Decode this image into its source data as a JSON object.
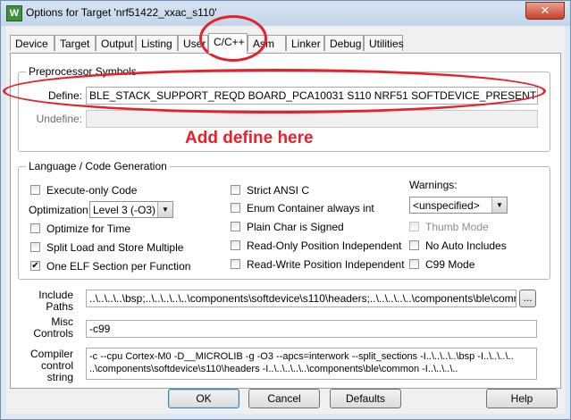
{
  "window": {
    "title": "Options for Target 'nrf51422_xxac_s110'",
    "close_glyph": "✕"
  },
  "tabs": [
    {
      "label": "Device"
    },
    {
      "label": "Target"
    },
    {
      "label": "Output"
    },
    {
      "label": "Listing"
    },
    {
      "label": "User"
    },
    {
      "label": "C/C++"
    },
    {
      "label": "Asm"
    },
    {
      "label": "Linker"
    },
    {
      "label": "Debug"
    },
    {
      "label": "Utilities"
    }
  ],
  "active_tab": "C/C++",
  "preprocessor": {
    "group_label": "Preprocessor Symbols",
    "define_label": "Define:",
    "define_value": "BLE_STACK_SUPPORT_REQD BOARD_PCA10031 S110 NRF51 SOFTDEVICE_PRESENT",
    "undefine_label": "Undefine:",
    "undefine_value": ""
  },
  "annotation": {
    "text": "Add define here",
    "color": "#e8202a"
  },
  "language": {
    "group_label": "Language / Code Generation",
    "execute_only": {
      "label": "Execute-only Code",
      "checked": false
    },
    "optimization_label": "Optimization:",
    "optimization_value": "Level 3 (-O3)",
    "optimize_time": {
      "label": "Optimize for Time",
      "checked": false
    },
    "split_load_store": {
      "label": "Split Load and Store Multiple",
      "checked": false
    },
    "one_elf": {
      "label": "One ELF Section per Function",
      "checked": true
    },
    "strict_ansi": {
      "label": "Strict ANSI C",
      "checked": false
    },
    "enum_container": {
      "label": "Enum Container always int",
      "checked": false
    },
    "plain_char": {
      "label": "Plain Char is Signed",
      "checked": false
    },
    "ro_pi": {
      "label": "Read-Only Position Independent",
      "checked": false
    },
    "rw_pi": {
      "label": "Read-Write Position Independent",
      "checked": false
    },
    "warnings_label": "Warnings:",
    "warnings_value": "<unspecified>",
    "thumb_mode": {
      "label": "Thumb Mode",
      "checked": false,
      "disabled": true
    },
    "no_auto_includes": {
      "label": "No Auto Includes",
      "checked": false
    },
    "c99_mode": {
      "label": "C99 Mode",
      "checked": false
    }
  },
  "include_paths": {
    "label_line1": "Include",
    "label_line2": "Paths",
    "value": "..\\..\\..\\..\\bsp;..\\..\\..\\..\\..\\components\\softdevice\\s110\\headers;..\\..\\..\\..\\..\\components\\ble\\commo",
    "browse_label": "..."
  },
  "misc_controls": {
    "label_line1": "Misc",
    "label_line2": "Controls",
    "value": "-c99"
  },
  "compiler_string": {
    "label_line1": "Compiler",
    "label_line2": "control",
    "label_line3": "string",
    "line1": "-c --cpu Cortex-M0 -D__MICROLIB -g -O3 --apcs=interwork --split_sections -I..\\..\\..\\..\\bsp -I..\\..\\..\\..",
    "line2": "..\\components\\softdevice\\s110\\headers -I..\\..\\..\\..\\..\\components\\ble\\common -I..\\..\\..\\.."
  },
  "buttons": {
    "ok": "OK",
    "cancel": "Cancel",
    "defaults": "Defaults",
    "help": "Help"
  },
  "glyphs": {
    "check": "✔",
    "dropdown_arrow": "▼"
  }
}
